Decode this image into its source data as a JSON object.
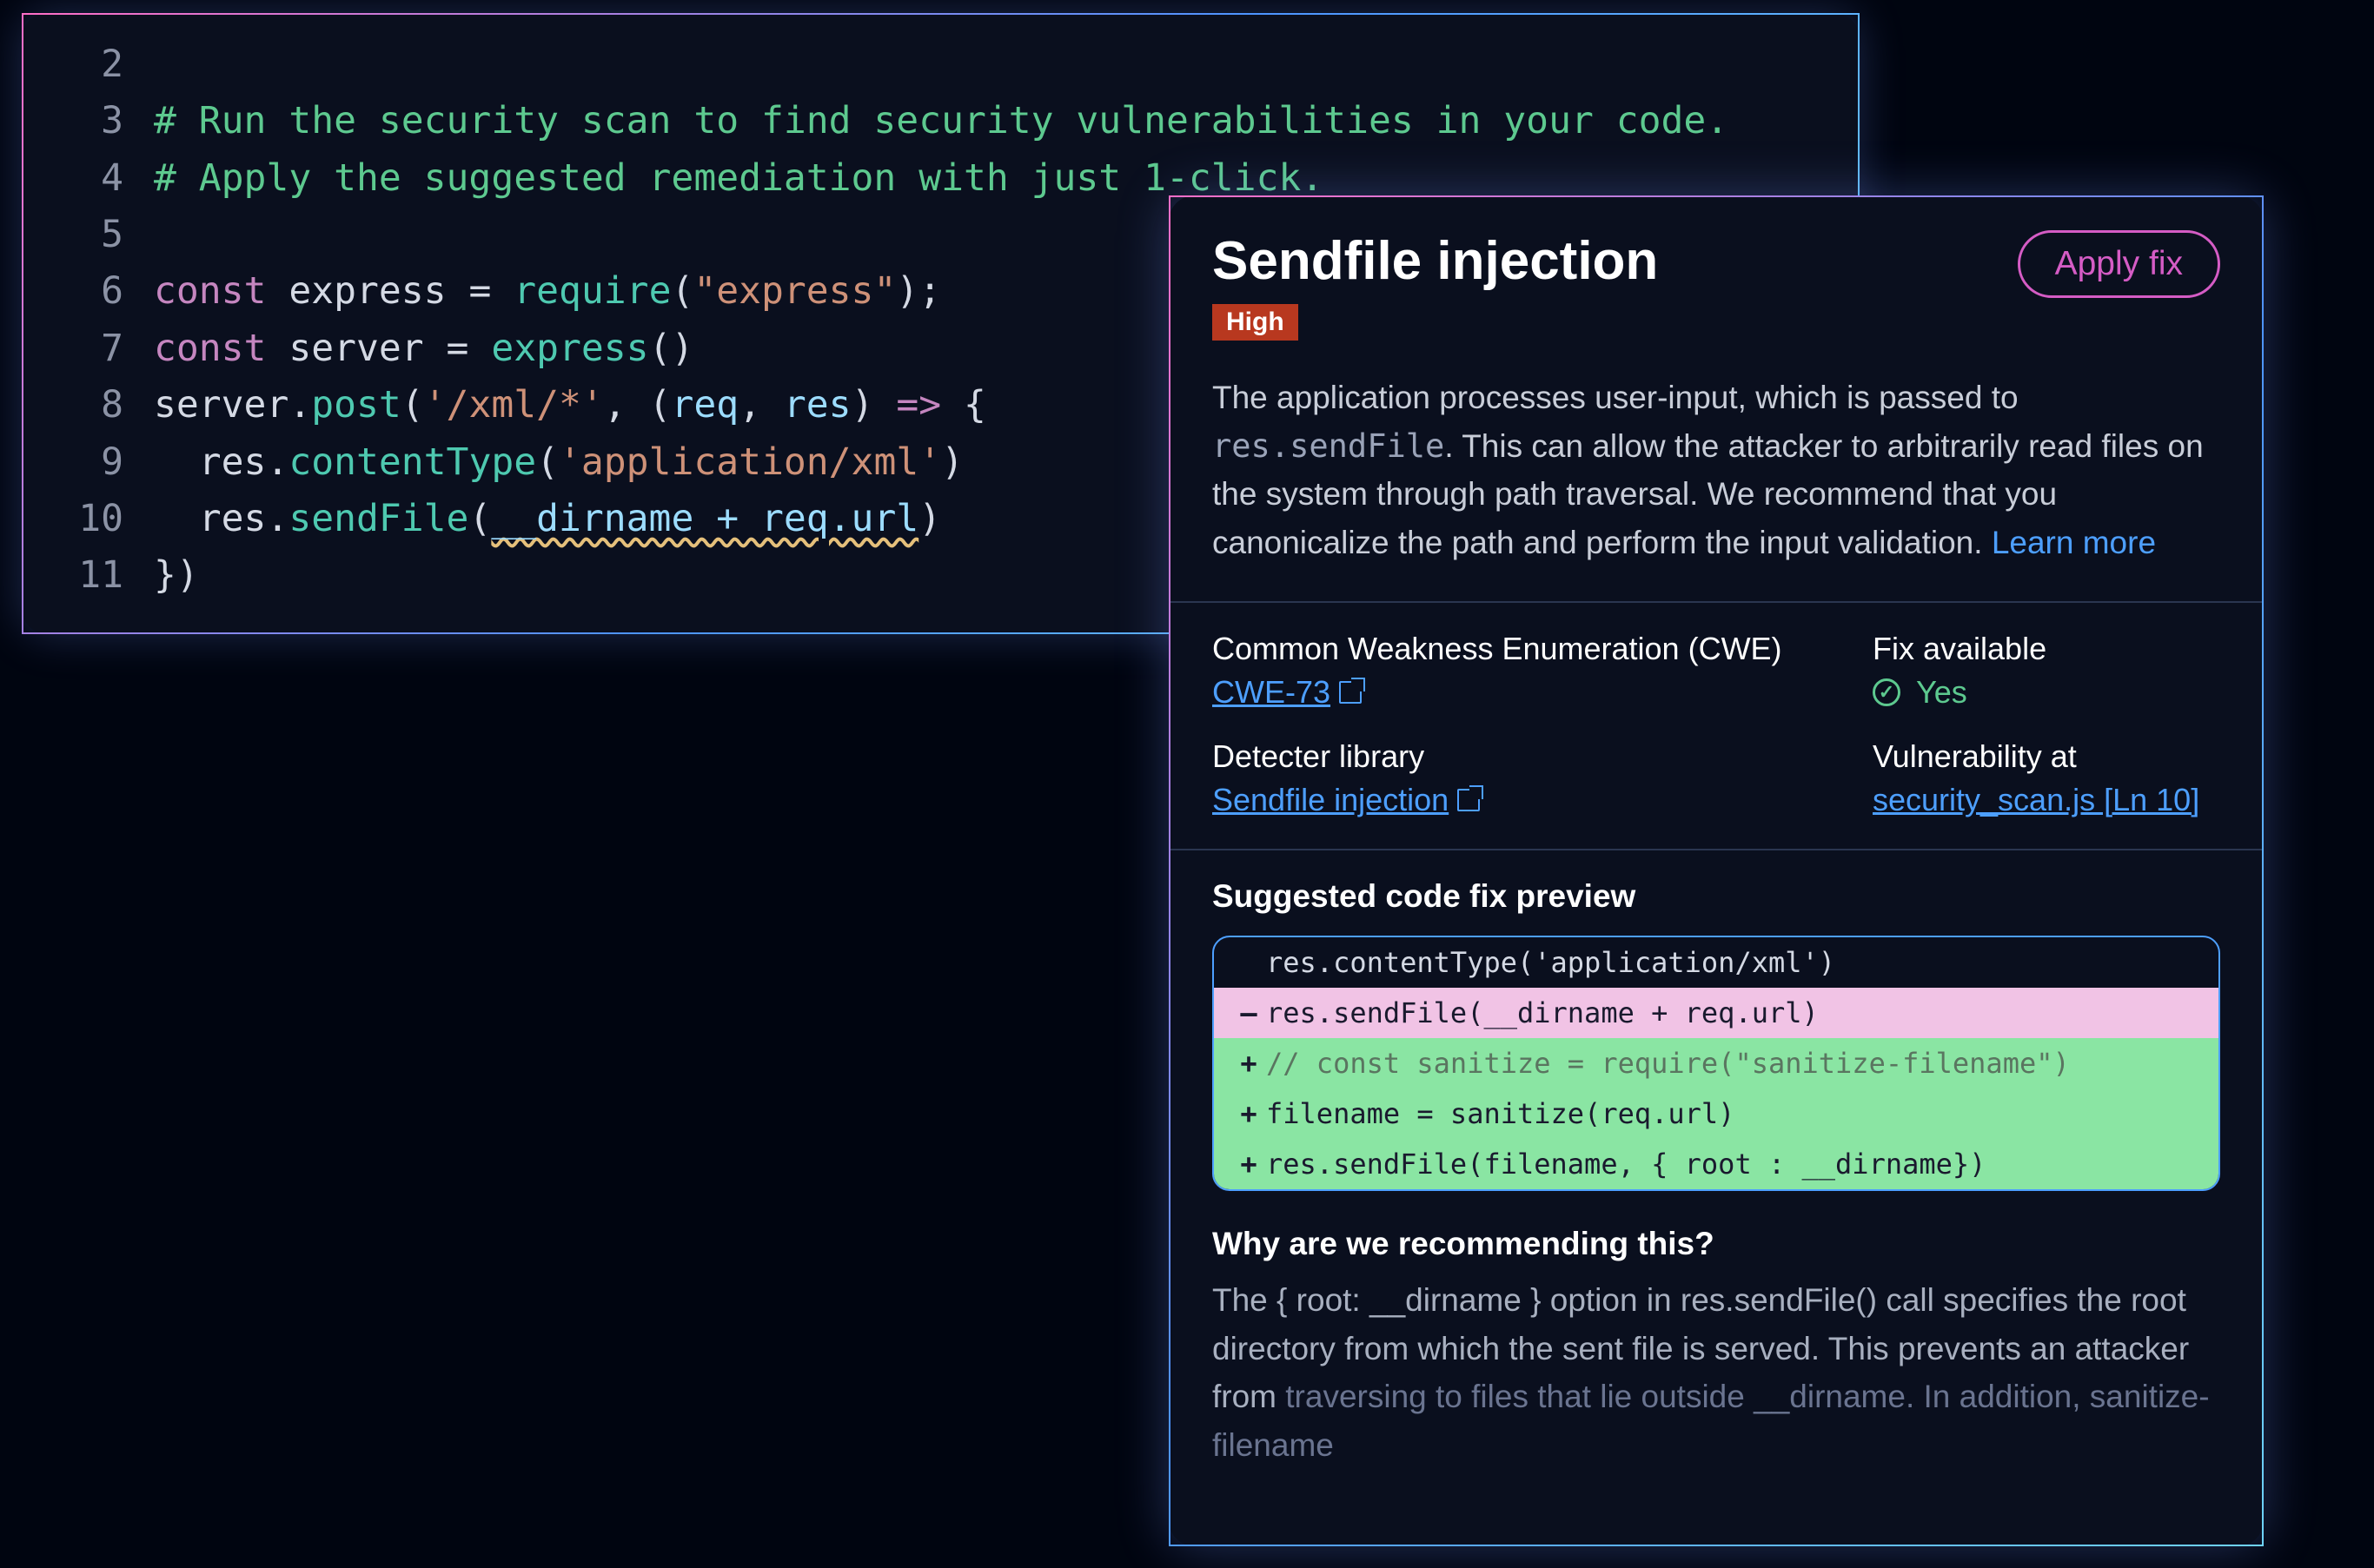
{
  "editor": {
    "lines": [
      {
        "num": "2",
        "content": []
      },
      {
        "num": "3",
        "content": [
          {
            "t": "# Run the security scan to find security vulnerabilities in your code.",
            "c": "comment"
          }
        ]
      },
      {
        "num": "4",
        "content": [
          {
            "t": "# Apply the suggested remediation with just 1-click.",
            "c": "comment"
          }
        ]
      },
      {
        "num": "5",
        "content": []
      },
      {
        "num": "6",
        "content": [
          {
            "t": "const ",
            "c": "keyword"
          },
          {
            "t": "express = ",
            "c": "var"
          },
          {
            "t": "require",
            "c": "func"
          },
          {
            "t": "(",
            "c": "var"
          },
          {
            "t": "\"express\"",
            "c": "string"
          },
          {
            "t": ");",
            "c": "var"
          }
        ]
      },
      {
        "num": "7",
        "content": [
          {
            "t": "const ",
            "c": "keyword"
          },
          {
            "t": "server = ",
            "c": "var"
          },
          {
            "t": "express",
            "c": "func"
          },
          {
            "t": "()",
            "c": "var"
          }
        ]
      },
      {
        "num": "8",
        "content": [
          {
            "t": "server.",
            "c": "var"
          },
          {
            "t": "post",
            "c": "func"
          },
          {
            "t": "(",
            "c": "var"
          },
          {
            "t": "'/xml/*'",
            "c": "string"
          },
          {
            "t": ", (",
            "c": "var"
          },
          {
            "t": "req",
            "c": "param"
          },
          {
            "t": ", ",
            "c": "var"
          },
          {
            "t": "res",
            "c": "param"
          },
          {
            "t": ") ",
            "c": "var"
          },
          {
            "t": "=>",
            "c": "keyword"
          },
          {
            "t": " {",
            "c": "var"
          }
        ]
      },
      {
        "num": "9",
        "content": [
          {
            "t": "  res.",
            "c": "var"
          },
          {
            "t": "contentType",
            "c": "func"
          },
          {
            "t": "(",
            "c": "var"
          },
          {
            "t": "'application/xml'",
            "c": "string"
          },
          {
            "t": ")",
            "c": "var"
          }
        ]
      },
      {
        "num": "10",
        "content": [
          {
            "t": "  res.",
            "c": "var"
          },
          {
            "t": "sendFile",
            "c": "func"
          },
          {
            "t": "(",
            "c": "var"
          },
          {
            "t": "__dirname + req.url",
            "c": "param wavy-underline"
          },
          {
            "t": ")",
            "c": "var"
          }
        ]
      },
      {
        "num": "11",
        "content": [
          {
            "t": "})",
            "c": "var"
          }
        ]
      }
    ]
  },
  "panel": {
    "title": "Sendfile injection",
    "severity": "High",
    "apply_fix_label": "Apply fix",
    "description_parts": {
      "pre": "The application processes user-input, which is passed to ",
      "mono": "res.sendFile",
      "mid": ". This can allow the attacker to arbitrarily read files on the system through path traversal. We recommend that you canonicalize the path and perform the input validation. ",
      "learn_more": "Learn more"
    },
    "meta": {
      "cwe_label": "Common Weakness Enumeration (CWE)",
      "cwe_value": "CWE-73",
      "fix_label": "Fix available",
      "fix_value": "Yes",
      "detector_label": "Detecter library",
      "detector_value": "Sendfile injection",
      "vuln_label": "Vulnerability at",
      "vuln_value": "security_scan.js [Ln 10]"
    },
    "preview": {
      "title": "Suggested code fix preview",
      "diff": [
        {
          "type": "context",
          "sign": "",
          "text": "res.contentType('application/xml')"
        },
        {
          "type": "removed",
          "sign": "—",
          "text": "res.sendFile(__dirname + req.url)"
        },
        {
          "type": "added",
          "sign": "+",
          "text": "// const sanitize = require(\"sanitize-filename\")",
          "comment": true
        },
        {
          "type": "added",
          "sign": "+",
          "text": "filename = sanitize(req.url)"
        },
        {
          "type": "added",
          "sign": "+",
          "text": "res.sendFile(filename, { root : __dirname})"
        }
      ]
    },
    "recommend": {
      "title": "Why are we recommending this?",
      "text_main": "The { root: __dirname } option in res.sendFile() call specifies the root directory from which the sent file is served. This prevents an attacker from ",
      "text_fade": "traversing to files that lie outside __dirname. In addition, sanitize-filename"
    }
  }
}
